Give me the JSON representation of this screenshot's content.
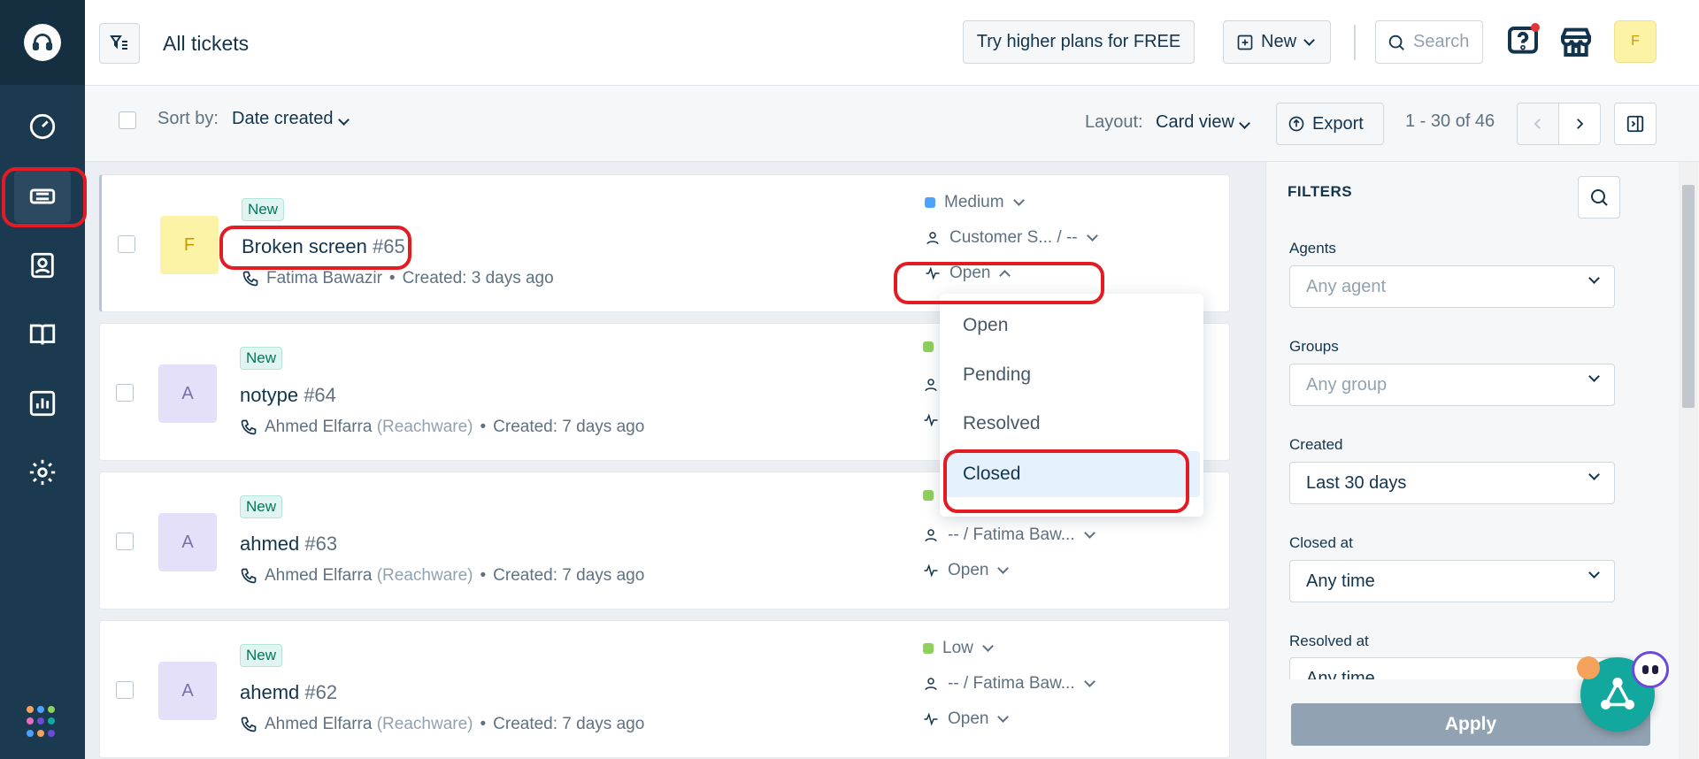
{
  "header": {
    "title": "All tickets",
    "try_button": "Try higher plans for FREE",
    "new_button": "New",
    "search_placeholder": "Search",
    "avatar_initial": "F"
  },
  "toolbar": {
    "sort_label": "Sort by:",
    "sort_value": "Date created",
    "layout_label": "Layout:",
    "layout_value": "Card view",
    "export_label": "Export",
    "pagination": "1 - 30 of 46"
  },
  "tickets": [
    {
      "initial": "F",
      "avatar_bg": "#fcf3a7",
      "avatar_fg": "#c99a00",
      "badge": "New",
      "title": "Broken screen",
      "number": "#65",
      "requester": "Fatima Bawazir",
      "company": "",
      "created": "Created: 3 days ago",
      "priority": "Medium",
      "priority_color": "#4da1ff",
      "assignee": "Customer S... / --",
      "status": "Open"
    },
    {
      "initial": "A",
      "avatar_bg": "#e5e0f9",
      "avatar_fg": "#7a6fa8",
      "badge": "New",
      "title": "notype",
      "number": "#64",
      "requester": "Ahmed Elfarra",
      "company": "(Reachware)",
      "created": "Created: 7 days ago",
      "priority": "",
      "priority_color": "#8fcf5b",
      "assignee": "",
      "status": ""
    },
    {
      "initial": "A",
      "avatar_bg": "#e5e0f9",
      "avatar_fg": "#7a6fa8",
      "badge": "New",
      "title": "ahmed",
      "number": "#63",
      "requester": "Ahmed Elfarra",
      "company": "(Reachware)",
      "created": "Created: 7 days ago",
      "priority": "",
      "priority_color": "#8fcf5b",
      "assignee": "-- / Fatima Baw...",
      "status": "Open"
    },
    {
      "initial": "A",
      "avatar_bg": "#e5e0f9",
      "avatar_fg": "#7a6fa8",
      "badge": "New",
      "title": "ahemd",
      "number": "#62",
      "requester": "Ahmed Elfarra",
      "company": "(Reachware)",
      "created": "Created: 7 days ago",
      "priority": "Low",
      "priority_color": "#8fcf5b",
      "assignee": "-- / Fatima Baw...",
      "status": "Open"
    }
  ],
  "status_dropdown": {
    "options": [
      "Open",
      "Pending",
      "Resolved",
      "Closed"
    ],
    "highlighted": "Closed"
  },
  "filters": {
    "title": "FILTERS",
    "agents_label": "Agents",
    "agents_placeholder": "Any agent",
    "groups_label": "Groups",
    "groups_placeholder": "Any group",
    "created_label": "Created",
    "created_value": "Last 30 days",
    "closed_label": "Closed at",
    "closed_value": "Any time",
    "resolved_label": "Resolved at",
    "resolved_value": "Any time",
    "apply_label": "Apply"
  },
  "colors": {
    "sidebar_bg": "#1c3a4f",
    "highlight_ring": "#e31c23",
    "accent_blue": "#4da1ff"
  }
}
